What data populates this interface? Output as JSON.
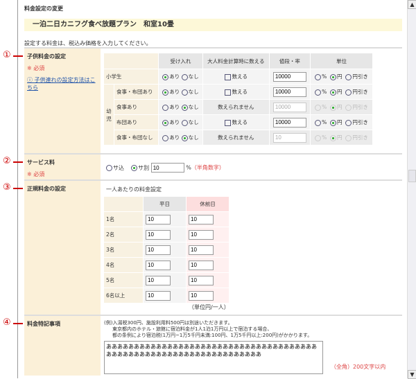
{
  "title": "料金設定の変更",
  "plan": "一泊二日カニフグ食べ放題プラン　和室10畳",
  "instruction": "設定する料金は、税込み価格を入力してください。",
  "required": "※ 必須",
  "markers": [
    "①",
    "②",
    "③",
    "④"
  ],
  "child": {
    "label": "子供料金の設定",
    "help_link": "子供連れの設定方法はこちら",
    "headers": [
      "受け入れ",
      "大人料金計算時に数える",
      "値段・率",
      "単位"
    ],
    "group": "幼児",
    "accept_opts": [
      "あり",
      "なし"
    ],
    "unit_opts": [
      "%",
      "円",
      "円引き"
    ],
    "count_label": "数える",
    "no_count": "数えられません",
    "rows": [
      {
        "name": "小学生",
        "accept": "あり",
        "countable": true,
        "price": "10000",
        "unit": "円",
        "enabled": true
      },
      {
        "name": "食事・布団あり",
        "accept": "あり",
        "countable": true,
        "price": "10000",
        "unit": "円",
        "enabled": true
      },
      {
        "name": "食事あり",
        "accept": "なし",
        "countable": false,
        "price": "10000",
        "unit": "円",
        "enabled": false
      },
      {
        "name": "布団あり",
        "accept": "あり",
        "countable": true,
        "price": "10000",
        "unit": "円",
        "enabled": true
      },
      {
        "name": "食事・布団なし",
        "accept": "なし",
        "countable": false,
        "price": "10",
        "unit": "円",
        "enabled": false
      }
    ]
  },
  "service": {
    "label": "サービス料",
    "opt_in": "サ込",
    "opt_out": "サ別",
    "value": "10",
    "unit": "%",
    "hint": "（半角数字）"
  },
  "regular": {
    "label": "正規料金の設定",
    "caption": "一人あたりの料金設定",
    "headers": [
      "平日",
      "休前日"
    ],
    "rows": [
      {
        "name": "1名",
        "weekday": "10",
        "holiday": "10"
      },
      {
        "name": "2名",
        "weekday": "10",
        "holiday": "10"
      },
      {
        "name": "3名",
        "weekday": "10",
        "holiday": "10"
      },
      {
        "name": "4名",
        "weekday": "10",
        "holiday": "10"
      },
      {
        "name": "5名",
        "weekday": "10",
        "holiday": "10"
      },
      {
        "name": "6名以上",
        "weekday": "10",
        "holiday": "10"
      }
    ],
    "unit_note": "（単位円/一人）"
  },
  "notes": {
    "label": "料金特記事項",
    "example": [
      "(例)入湯税300円、施設利用料500円は別途いただきます。",
      "東京都内のホテル・旅館に宿泊料金が1人1泊1万円以上で宿泊する場合、",
      "都の条例により宿泊税(1万円~1万5千円未満:100円、1万5千円以上:200円)がかかります。"
    ],
    "value": "ああああああああああああああああああああああああああああああああああああああああああああああああああああああああああああああああああ",
    "limit": "（全角）200文字以内"
  }
}
